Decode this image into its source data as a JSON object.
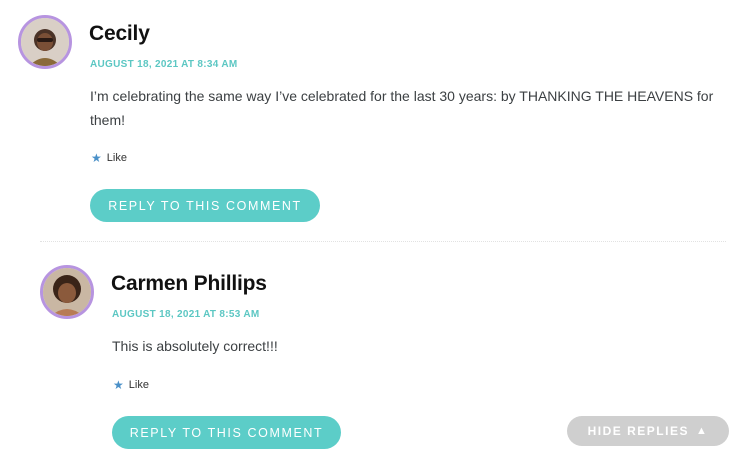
{
  "comments": [
    {
      "author": "Cecily",
      "date": "AUGUST 18, 2021 AT 8:34 AM",
      "text": "I’m celebrating the same way I’ve celebrated for the last 30 years: by THANKING THE HEAVENS for them!",
      "like_label": "Like",
      "reply_label": "REPLY TO THIS COMMENT"
    },
    {
      "author": "Carmen Phillips",
      "date": "AUGUST 18, 2021 AT 8:53 AM",
      "text": "This is absolutely correct!!!",
      "like_label": "Like",
      "reply_label": "REPLY TO THIS COMMENT"
    }
  ],
  "hide_replies_label": "HIDE REPLIES",
  "icons": {
    "like": "star-icon",
    "hide": "triangle-up-icon"
  },
  "colors": {
    "accent": "#5ccdc8",
    "avatar_ring": "#b794e0",
    "meta": "#5cc7c3",
    "hide_button": "#cfcfcf"
  }
}
